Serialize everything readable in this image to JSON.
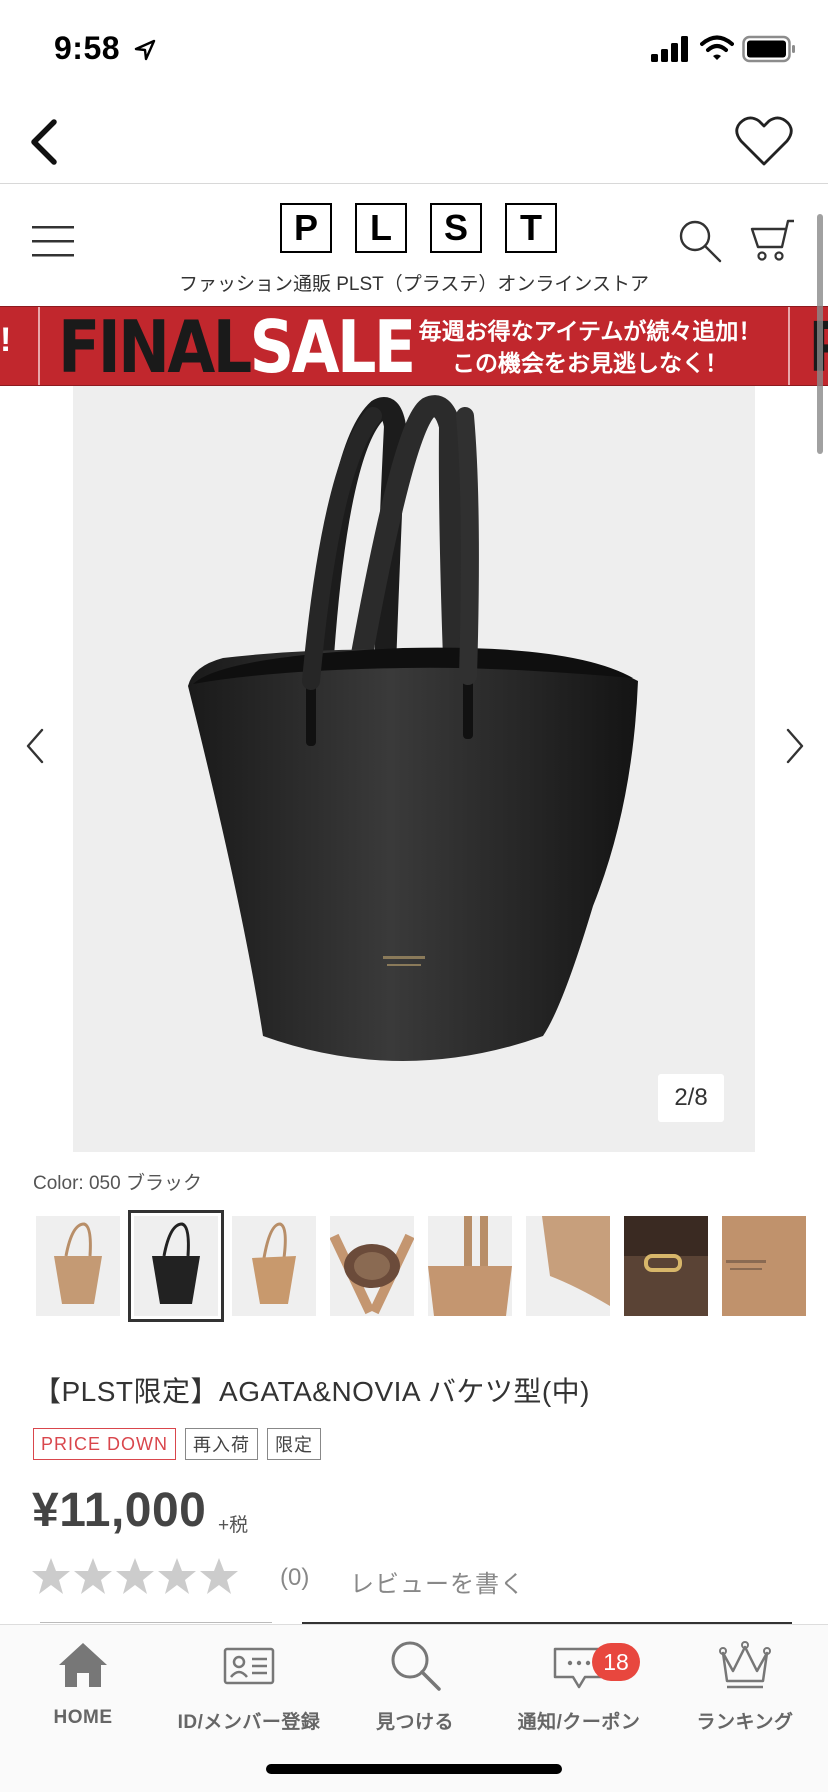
{
  "status_bar": {
    "time": "9:58",
    "icons": [
      "location-arrow-icon",
      "signal-bars-icon",
      "wifi-icon",
      "battery-icon"
    ]
  },
  "navbar": {
    "back_icon": "chevron-left-icon",
    "favorite_icon": "heart-icon"
  },
  "header": {
    "logo_letters": [
      "P",
      "L",
      "S",
      "T"
    ],
    "tagline": "ファッション通販 PLST（プラステ）オンラインストア",
    "icons": [
      "hamburger-menu-icon",
      "search-icon",
      "cart-icon"
    ]
  },
  "sale_banner": {
    "final": "FINAL",
    "sale": "SALE",
    "message_line1": "毎週お得なアイテムが続々追加！",
    "message_line2": "この機会をお見逃しなく！",
    "edge_left": "!",
    "edge_right": "F",
    "color": "#c1272d"
  },
  "product": {
    "image_counter": "2/8",
    "color_label": "Color: 050 ブラック",
    "thumbnails": [
      {
        "name": "camel-bucket-front",
        "tone": "#c49a74"
      },
      {
        "name": "black-bucket-front",
        "tone": "#222222",
        "selected": true
      },
      {
        "name": "camel-bucket-angle",
        "tone": "#c8996d"
      },
      {
        "name": "camel-bucket-inside",
        "tone": "#8a6a52"
      },
      {
        "name": "camel-bucket-side",
        "tone": "#c49670"
      },
      {
        "name": "camel-bucket-detail",
        "tone": "#c79f7c"
      },
      {
        "name": "brown-bucket-clasp",
        "tone": "#5a4335"
      },
      {
        "name": "camel-bucket-logo",
        "tone": "#c0926c"
      }
    ],
    "title": "【PLST限定】AGATA&NOVIA バケツ型(中)",
    "tags": [
      {
        "label": "PRICE DOWN",
        "style": "red"
      },
      {
        "label": "再入荷",
        "style": "gray"
      },
      {
        "label": "限定",
        "style": "gray"
      }
    ],
    "price": "¥11,000",
    "tax_note": "+税",
    "rating_stars": 0,
    "review_count": "(0)",
    "review_link": "レビューを書く"
  },
  "tabbar": {
    "tabs": [
      {
        "label": "HOME",
        "icon": "home-icon"
      },
      {
        "label": "ID/メンバー登録",
        "icon": "id-card-icon"
      },
      {
        "label": "見つける",
        "icon": "search-icon"
      },
      {
        "label": "通知/クーポン",
        "icon": "chat-bubble-icon",
        "badge": "18"
      },
      {
        "label": "ランキング",
        "icon": "crown-icon"
      }
    ],
    "badge_color": "#e8473e"
  }
}
